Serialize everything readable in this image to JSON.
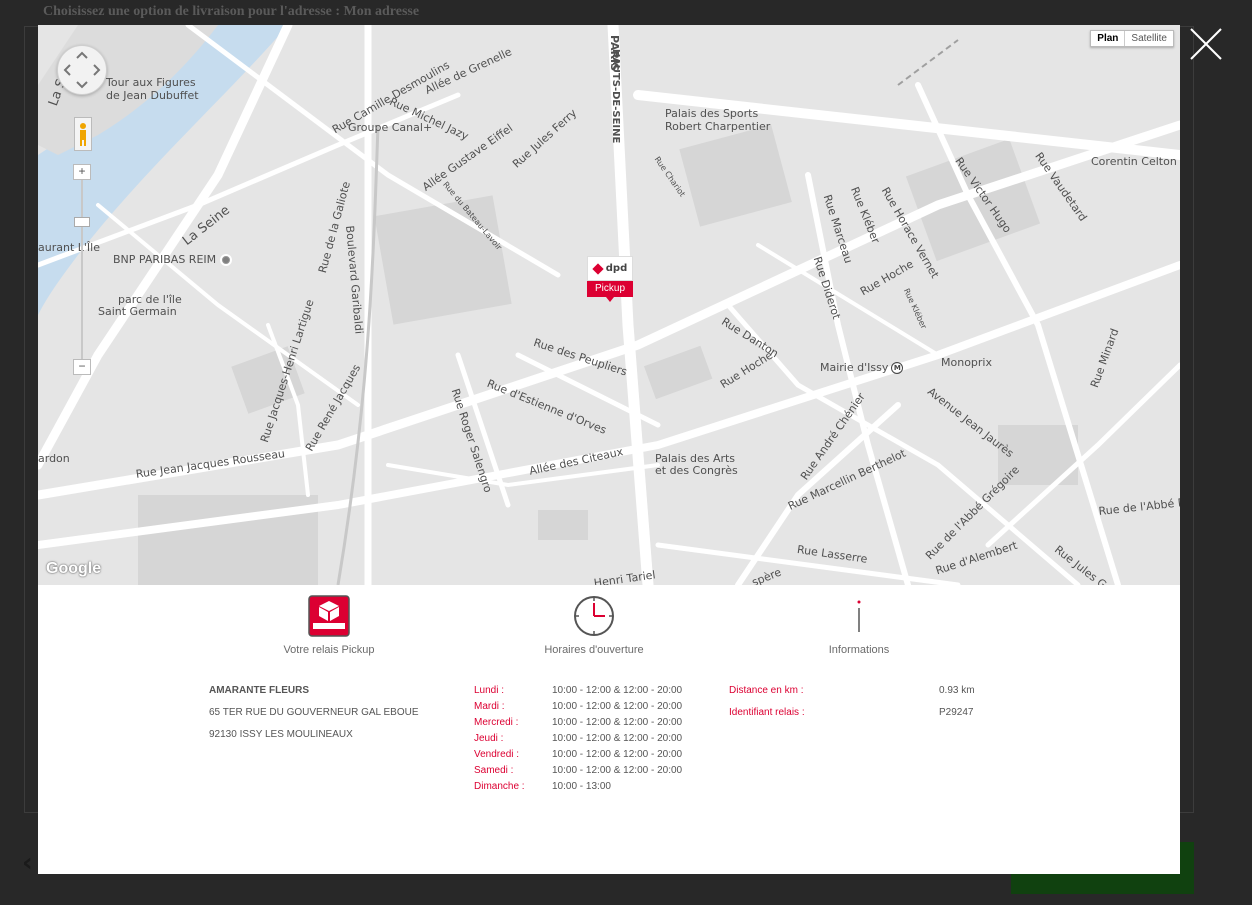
{
  "background_page": {
    "title": "Choisissez une option de livraison pour l'adresse : Mon adresse"
  },
  "map": {
    "map_type_options": [
      "Plan",
      "Satellite"
    ],
    "active_map_type": "Plan",
    "attribution": "Google",
    "marker": {
      "brand": "dpd",
      "label": "Pickup"
    },
    "labels": {
      "tour": "Tour aux Figures",
      "tour2": "de Jean Dubuffet",
      "la_seine_left": "La S",
      "la_seine": "La Seine",
      "bnp": "BNP PARIBAS REIM",
      "restaurant": "aurant L'Île",
      "parc1": "parc de l'île",
      "parc2": "Saint Germain",
      "paris": "PARIS",
      "hauts_de_seine": "HAUTS-DE-SEINE",
      "palais_sports1": "Palais des Sports",
      "palais_sports2": "Robert Charpentier",
      "corentin": "Corentin Celton",
      "groupe_canal": "Groupe Canal+",
      "rue_camille": "Rue Camille Desmoulins",
      "allee_grenelle": "Allée de Grenelle",
      "rue_michel": "Rue Michel Jazy",
      "allee_eiffel": "Allée Gustave Eiffel",
      "rue_jules_ferry": "Rue Jules Ferry",
      "rue_bateau": "Rue du Bateau-Lavoir",
      "rue_galiote": "Rue de la Galiote",
      "bd_garibaldi": "Boulevard Garibaldi",
      "rue_chariot": "Rue Chariot",
      "rue_kleber": "Rue Kléber",
      "rue_marceau": "Rue Marceau",
      "rue_horace": "Rue Horace Vernet",
      "rue_victor": "Rue Victor Hugo",
      "rue_vaudetard": "Rue Vaudetard",
      "rue_diderot": "Rue Diderot",
      "rue_hoche_top": "Rue Hoche",
      "rue_kleber_small": "Rue Kléber",
      "rue_danton": "Rue Danton",
      "rue_hoche": "Rue Hoche",
      "mairie": "Mairie d'Issy",
      "monoprix": "Monoprix",
      "rue_peupliers": "Rue des Peupliers",
      "rue_estienne": "Rue d'Estienne d'Orves",
      "rue_lartigue": "Rue Jacques-Henri Lartigue",
      "rue_rene": "Rue René Jacques",
      "rue_roger": "Rue Roger Salengro",
      "allee_citeaux": "Allée des Citeaux",
      "palais_arts1": "Palais des Arts",
      "palais_arts2": "et des Congrès",
      "avenue_jaures": "Avenue Jean Jaurès",
      "rue_chenier": "Rue André Chénier",
      "rue_berthelot": "Rue Marcellin Berthelot",
      "rue_rousseau": "Rue Jean Jacques Rousseau",
      "ardon": "ardon",
      "rue_minard": "Rue Minard",
      "rue_abbe_d": "Rue de l'Abbé D",
      "rue_gregoire": "Rue de l'Abbé Grégoire",
      "rue_alembert": "Rue d'Alembert",
      "rue_lasserre": "Rue Lasserre",
      "rue_jules_g": "Rue Jules G",
      "rue_tariel": "Henri Tariel",
      "rue_spere": "spère"
    }
  },
  "sections": {
    "relay": {
      "title": "Votre relais Pickup",
      "icon": "dpd-parcel-icon"
    },
    "hours": {
      "title": "Horaires d'ouverture",
      "icon": "clock-icon"
    },
    "info": {
      "title": "Informations",
      "icon": "info-icon"
    }
  },
  "relay": {
    "name": "AMARANTE FLEURS",
    "address_line1": "65 TER RUE DU GOUVERNEUR GAL EBOUE",
    "address_line2": "92130 ISSY LES MOULINEAUX"
  },
  "hours": [
    {
      "day": "Lundi :",
      "time": "10:00 - 12:00 & 12:00 - 20:00"
    },
    {
      "day": "Mardi :",
      "time": "10:00 - 12:00 & 12:00 - 20:00"
    },
    {
      "day": "Mercredi :",
      "time": "10:00 - 12:00 & 12:00 - 20:00"
    },
    {
      "day": "Jeudi :",
      "time": "10:00 - 12:00 & 12:00 - 20:00"
    },
    {
      "day": "Vendredi :",
      "time": "10:00 - 12:00 & 12:00 - 20:00"
    },
    {
      "day": "Samedi :",
      "time": "10:00 - 12:00 & 12:00 - 20:00"
    },
    {
      "day": "Dimanche :",
      "time": "10:00 - 13:00"
    }
  ],
  "informations": [
    {
      "label": "Distance en km :",
      "value": "0.93 km"
    },
    {
      "label": "Identifiant relais :",
      "value": "P29247"
    }
  ],
  "colors": {
    "dpd_red": "#dc0032",
    "text_gray": "#555555",
    "map_bg": "#e5e5e5",
    "road": "#ffffff",
    "water": "#c6dcee"
  }
}
